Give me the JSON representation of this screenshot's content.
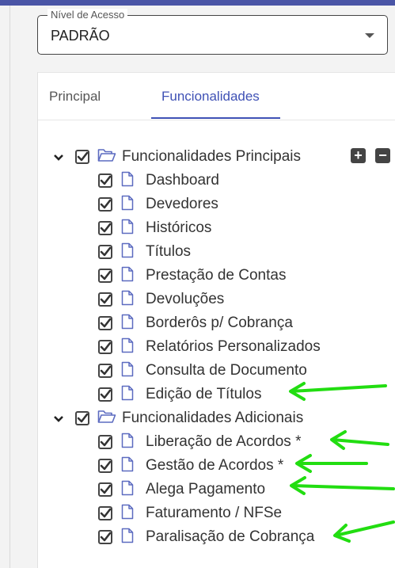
{
  "access_level": {
    "legend": "Nível de Acesso",
    "value": "PADRÃO"
  },
  "tabs": [
    {
      "label": "Principal",
      "active": false
    },
    {
      "label": "Funcionalidades",
      "active": true
    }
  ],
  "tree": {
    "groups": [
      {
        "label": "Funcionalidades Principais",
        "items": [
          "Dashboard",
          "Devedores",
          "Históricos",
          "Títulos",
          "Prestação de Contas",
          "Devoluções",
          "Borderôs p/ Cobrança",
          "Relatórios Personalizados",
          "Consulta de Documento",
          "Edição de Títulos"
        ]
      },
      {
        "label": "Funcionalidades Adicionais",
        "items": [
          "Liberação de Acordos *",
          "Gestão de Acordos *",
          "Alega Pagamento",
          "Faturamento / NFSe",
          "Paralisação de Cobrança"
        ]
      }
    ],
    "expand_all_symbol": "+",
    "collapse_all_symbol": "−"
  },
  "colors": {
    "accent": "#3f51b5",
    "arrow": "#22dd11",
    "topbar": "#4a55a6"
  }
}
